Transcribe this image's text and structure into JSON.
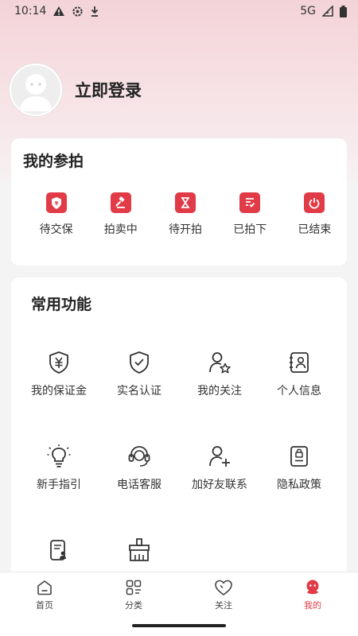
{
  "status_bar": {
    "time": "10:14",
    "network": "5G",
    "icons": [
      "alert-icon",
      "settings-icon",
      "download-icon",
      "signal-icon",
      "battery-icon"
    ]
  },
  "profile": {
    "login_label": "立即登录"
  },
  "my_auctions": {
    "title": "我的参拍",
    "items": [
      {
        "label": "待交保",
        "icon": "yuan-shield-icon"
      },
      {
        "label": "拍卖中",
        "icon": "gavel-icon"
      },
      {
        "label": "待开拍",
        "icon": "hourglass-icon"
      },
      {
        "label": "已拍下",
        "icon": "checklist-icon"
      },
      {
        "label": "已结束",
        "icon": "power-icon"
      }
    ]
  },
  "common_functions": {
    "title": "常用功能",
    "items": [
      {
        "label": "我的保证金",
        "icon": "deposit-shield-icon"
      },
      {
        "label": "实名认证",
        "icon": "verify-shield-icon"
      },
      {
        "label": "我的关注",
        "icon": "user-star-icon"
      },
      {
        "label": "个人信息",
        "icon": "contact-card-icon"
      },
      {
        "label": "新手指引",
        "icon": "lightbulb-icon"
      },
      {
        "label": "电话客服",
        "icon": "headset-icon"
      },
      {
        "label": "加好友联系",
        "icon": "add-friend-icon"
      },
      {
        "label": "隐私政策",
        "icon": "privacy-doc-icon"
      },
      {
        "label": "",
        "icon": "document-user-icon"
      },
      {
        "label": "",
        "icon": "clear-cache-icon"
      }
    ]
  },
  "tabbar": {
    "tabs": [
      {
        "label": "首页",
        "icon": "home-icon"
      },
      {
        "label": "分类",
        "icon": "category-icon"
      },
      {
        "label": "关注",
        "icon": "heart-icon"
      },
      {
        "label": "我的",
        "icon": "mascot-icon"
      }
    ],
    "active_index": 3
  },
  "colors": {
    "accent": "#e03b47",
    "header_gradient_top": "#f3d3d8",
    "background": "#f4f4f4"
  }
}
